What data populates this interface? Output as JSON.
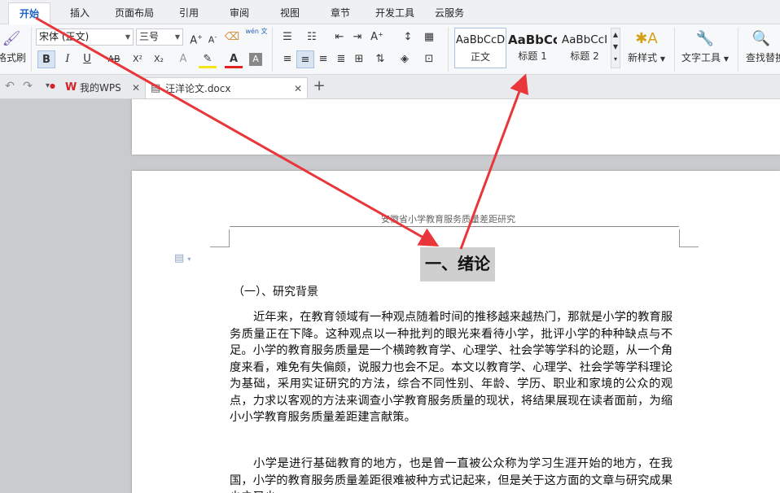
{
  "menubar": {
    "tabs": [
      {
        "label": "开始",
        "active": true
      },
      {
        "label": "插入"
      },
      {
        "label": "页面布局"
      },
      {
        "label": "引用"
      },
      {
        "label": "审阅"
      },
      {
        "label": "视图"
      },
      {
        "label": "章节"
      },
      {
        "label": "开发工具"
      },
      {
        "label": "云服务"
      }
    ]
  },
  "ribbon": {
    "format_painter_label": "格式刷",
    "font_name": "宋体 (正文)",
    "font_size": "三号",
    "bold": "B",
    "italic": "I",
    "underline": "U",
    "strike": "AB",
    "superscript": "X²",
    "subscript": "X₂",
    "font_color": "A",
    "styles": [
      {
        "sample": "AaBbCcD",
        "label": "正文"
      },
      {
        "sample": "AaBbCc",
        "label": "标题 1"
      },
      {
        "sample": "AaBbCcI",
        "label": "标题 2"
      }
    ],
    "new_style_label": "新样式",
    "text_tools_label": "文字工具",
    "find_replace_label": "查找替换",
    "phonetic_label": "wén 文"
  },
  "tabbar": {
    "tabs": [
      {
        "label": "我的WPS",
        "active": false
      },
      {
        "label": "汪洋论文.docx",
        "active": true
      }
    ],
    "add_label": "+"
  },
  "document": {
    "header_text": "安徽省小学教育服务质量差距研究",
    "chapter_title": "一、绪论",
    "section_title": "（一）、研究背景",
    "paragraphs": [
      "近年来，在教育领域有一种观点随着时间的推移越来越热门，那就是小学的教育服务质量正在下降。这种观点以一种批判的眼光来看待小学，批评小学的种种缺点与不足。小学的教育服务质量是一个横跨教育学、心理学、社会学等学科的论题，从一个角度来看，难免有失偏颇，说服力也会不足。本文以教育学、心理学、社会学等学科理论为基础，采用实证研究的方法，综合不同性别、年龄、学历、职业和家境的公众的观点，力求以客观的方法来调查小学教育服务质量的现状，将结果展现在读者面前，为缩小小学教育服务质量差距建言献策。",
      "小学是进行基础教育的地方，也是曾一直被公众称为学习生涯开始的地方，在我国，小学的教育服务质量差距很难被种方式记起来，但是关于这方面的文章与研究成果少之又少"
    ]
  },
  "colors": {
    "accent_blue": "#1f63c6",
    "arrow_red": "#e8363a",
    "wps_red": "#d6232a"
  }
}
